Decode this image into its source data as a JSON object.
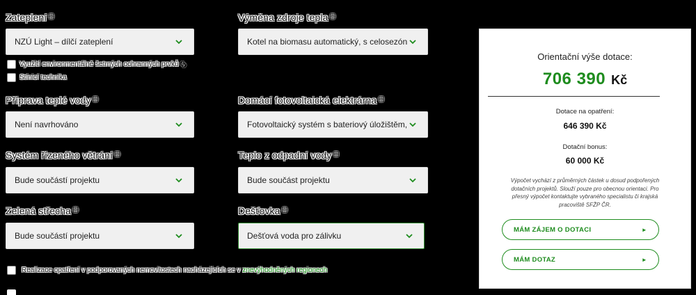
{
  "fields": {
    "zatepleni": {
      "label": "Zateplení",
      "value": "NZÚ Light – dílčí zateplení"
    },
    "vymena_zdroje": {
      "label": "Výměna zdroje tepla",
      "value": "Kotel na biomasu automatický, s celosezónním"
    },
    "priprava_vody": {
      "label": "Příprava teplé vody",
      "value": "Není navrhováno"
    },
    "fotovoltaika": {
      "label": "Domácí fotovoltaická elektrárna",
      "value": "Fotovoltaický systém s bateriový úložištěm, ch"
    },
    "vetrani": {
      "label": "Systém řízeného větrání",
      "value": "Bude součástí projektu"
    },
    "odpadni_voda": {
      "label": "Teplo z odpadní vody",
      "value": "Bude součást projektu"
    },
    "strecha": {
      "label": "Zelená střecha",
      "value": "Bude součástí projektu"
    },
    "destovka": {
      "label": "Dešťovka",
      "value": "Dešťová voda pro zálivku"
    }
  },
  "info_glyph": "ⓘ",
  "checkboxes": {
    "vyuziti": "Využití environmentálně šetrných ochranných prvků",
    "stinici": "Stínicí technika",
    "regiony_prefix": "Realizace opatření v podporovaných nemovitostech nacházejících se v ",
    "regiony_link": "znevýhodněných regionech"
  },
  "panel": {
    "title": "Orientační výše dotace:",
    "amount": "706 390",
    "currency": "Kč",
    "measures_label": "Dotace na opatření:",
    "measures_value": "646 390 Kč",
    "bonus_label": "Dotační bonus:",
    "bonus_value": "60 000 Kč",
    "note": "Výpočet vychází z průměrných částek u dosud podpořených dotačních projektů. Slouží pouze pro obecnou orientaci. Pro přesný výpočet kontaktujte vybraného specialistu či krajská pracoviště SFŽP ČR.",
    "btn_interest": "MÁM ZÁJEM O DOTACI",
    "btn_question": "MÁM DOTAZ",
    "arrow": "►"
  },
  "colors": {
    "accent": "#1e8c1e",
    "panel_bg": "#ffffff",
    "select_bg": "#f0f0f0",
    "page_bg": "#000000"
  }
}
